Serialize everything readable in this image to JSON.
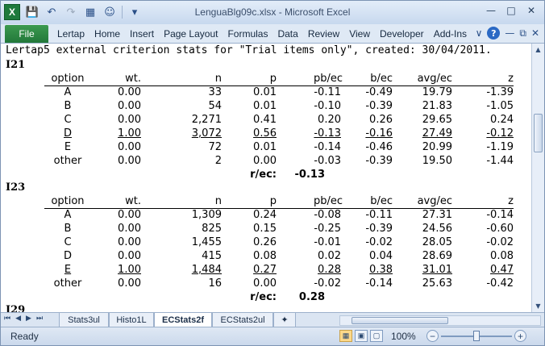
{
  "window": {
    "title": "LenguaBlg09c.xlsx  -  Microsoft Excel",
    "app_icon": "X",
    "controls": [
      "minimize-icon",
      "restore-icon",
      "close-icon"
    ]
  },
  "quick_access": [
    "save-icon",
    "undo-icon",
    "redo-icon",
    "table-icon",
    "smiley-icon",
    "customize-icon"
  ],
  "ribbon": {
    "file_tab": "File",
    "tabs": [
      "Lertap",
      "Home",
      "Insert",
      "Page Layout",
      "Formulas",
      "Data",
      "Review",
      "View",
      "Developer",
      "Add-Ins"
    ],
    "right_icons": [
      "minimize-ribbon-icon",
      "help-icon",
      "window-min-icon",
      "window-restore-icon",
      "window-close-icon"
    ]
  },
  "sheet": {
    "header_line": "Lertap5 external criterion stats for \"Trial items only\", created: 30/04/2011.",
    "columns": [
      "option",
      "wt.",
      "n",
      "p",
      "pb/ec",
      "b/ec",
      "avg/ec",
      "z"
    ],
    "items": [
      {
        "label": "I21",
        "rows": [
          {
            "option": "A",
            "wt": "0.00",
            "n": "33",
            "p": "0.01",
            "pb": "-0.11",
            "b": "-0.49",
            "avg": "19.79",
            "z": "-1.39",
            "key": false
          },
          {
            "option": "B",
            "wt": "0.00",
            "n": "54",
            "p": "0.01",
            "pb": "-0.10",
            "b": "-0.39",
            "avg": "21.83",
            "z": "-1.05",
            "key": false
          },
          {
            "option": "C",
            "wt": "0.00",
            "n": "2,271",
            "p": "0.41",
            "pb": "0.20",
            "b": "0.26",
            "avg": "29.65",
            "z": "0.24",
            "key": false
          },
          {
            "option": "D",
            "wt": "1.00",
            "n": "3,072",
            "p": "0.56",
            "pb": "-0.13",
            "b": "-0.16",
            "avg": "27.49",
            "z": "-0.12",
            "key": true
          },
          {
            "option": "E",
            "wt": "0.00",
            "n": "72",
            "p": "0.01",
            "pb": "-0.14",
            "b": "-0.46",
            "avg": "20.99",
            "z": "-1.19",
            "key": false
          },
          {
            "option": "other",
            "wt": "0.00",
            "n": "2",
            "p": "0.00",
            "pb": "-0.03",
            "b": "-0.39",
            "avg": "19.50",
            "z": "-1.44",
            "key": false
          }
        ],
        "rec_label": "r/ec:",
        "rec_value": "-0.13"
      },
      {
        "label": "I23",
        "rows": [
          {
            "option": "A",
            "wt": "0.00",
            "n": "1,309",
            "p": "0.24",
            "pb": "-0.08",
            "b": "-0.11",
            "avg": "27.31",
            "z": "-0.14",
            "key": false
          },
          {
            "option": "B",
            "wt": "0.00",
            "n": "825",
            "p": "0.15",
            "pb": "-0.25",
            "b": "-0.39",
            "avg": "24.56",
            "z": "-0.60",
            "key": false
          },
          {
            "option": "C",
            "wt": "0.00",
            "n": "1,455",
            "p": "0.26",
            "pb": "-0.01",
            "b": "-0.02",
            "avg": "28.05",
            "z": "-0.02",
            "key": false
          },
          {
            "option": "D",
            "wt": "0.00",
            "n": "415",
            "p": "0.08",
            "pb": "0.02",
            "b": "0.04",
            "avg": "28.69",
            "z": "0.08",
            "key": false
          },
          {
            "option": "E",
            "wt": "1.00",
            "n": "1,484",
            "p": "0.27",
            "pb": "0.28",
            "b": "0.38",
            "avg": "31.01",
            "z": "0.47",
            "key": true
          },
          {
            "option": "other",
            "wt": "0.00",
            "n": "16",
            "p": "0.00",
            "pb": "-0.02",
            "b": "-0.14",
            "avg": "25.63",
            "z": "-0.42",
            "key": false
          }
        ],
        "rec_label": "r/ec:",
        "rec_value": "0.28"
      }
    ],
    "next_item_label": "I29"
  },
  "sheet_tabs": {
    "nav": [
      "first-sheet-icon",
      "prev-sheet-icon",
      "next-sheet-icon",
      "last-sheet-icon"
    ],
    "tabs": [
      "Stats3ul",
      "Histo1L",
      "ECStats2f",
      "ECStats2ul"
    ],
    "active": "ECStats2f"
  },
  "status_bar": {
    "ready": "Ready",
    "zoom": "100%",
    "zoom_level": 1.0
  },
  "colors": {
    "file_tab": "#2a8a43",
    "accent": "#2b69c4"
  }
}
